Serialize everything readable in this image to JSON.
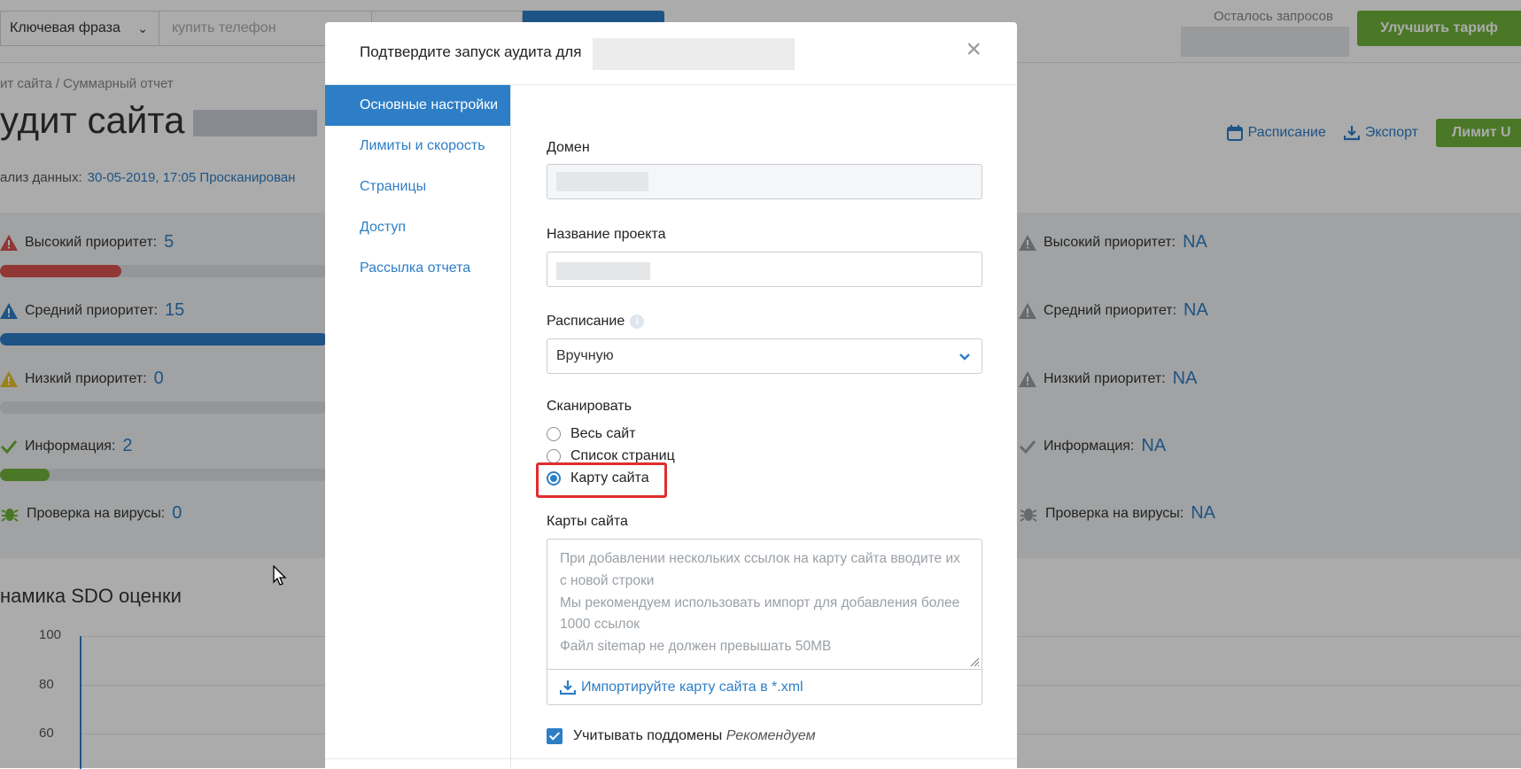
{
  "topbar": {
    "keyword_select": "Ключевая фраза",
    "keyword_placeholder": "купить телефон",
    "remaining_label": "Осталось запросов",
    "upgrade_button": "Улучшить тариф"
  },
  "page": {
    "breadcrumb": "ит сайта / Суммарный отчет",
    "title": "удит сайта",
    "data_label": "ализ данных:",
    "data_value": "30-05-2019, 17:05 Просканирован",
    "actions": {
      "schedule": "Расписание",
      "export": "Экспорт",
      "limit": "Лимит U"
    }
  },
  "stats_left": [
    {
      "label": "Высокий приоритет:",
      "value": "5",
      "color": "#d9534f",
      "fill": 0.37
    },
    {
      "label": "Средний приоритет:",
      "value": "15",
      "color": "#2d7ec6",
      "fill": 1.0
    },
    {
      "label": "Низкий приоритет:",
      "value": "0",
      "color": "#e6c02b",
      "fill": 0
    },
    {
      "label": "Информация:",
      "value": "2",
      "color": "#6fb33a",
      "fill": 0.15
    },
    {
      "label": "Проверка на вирусы:",
      "value": "0",
      "color": "#6fb33a",
      "fill": 0
    }
  ],
  "stats_right": [
    {
      "label": "Высокий приоритет:",
      "value": "NA"
    },
    {
      "label": "Средний приоритет:",
      "value": "NA"
    },
    {
      "label": "Низкий приоритет:",
      "value": "NA"
    },
    {
      "label": "Информация:",
      "value": "NA"
    },
    {
      "label": "Проверка на вирусы:",
      "value": "NA"
    }
  ],
  "chart": {
    "title": "намика SDO оценки",
    "y_ticks": [
      "100",
      "80",
      "60"
    ]
  },
  "modal": {
    "title": "Подтвердите запуск аудита для",
    "close": "×",
    "nav": [
      "Основные настройки",
      "Лимиты и скорость",
      "Страницы",
      "Доступ",
      "Рассылка отчета"
    ],
    "domain_label": "Домен",
    "project_label": "Название проекта",
    "schedule_label": "Расписание",
    "schedule_info": "i",
    "schedule_value": "Вручную",
    "scan_label": "Сканировать",
    "scan_options": [
      "Весь сайт",
      "Список страниц",
      "Карту сайта"
    ],
    "scan_selected": "Карту сайта",
    "sitemaps_label": "Карты сайта",
    "sitemaps_placeholder": [
      "При добавлении нескольких ссылок на карту сайта вводите их с новой строки",
      "Мы рекомендуем использовать импорт для добавления более 1000 ссылок",
      "Файл sitemap не должен превышать 50MB"
    ],
    "import_link": "Импортируйте карту сайта в *.xml",
    "subdomains_label": "Учитывать поддомены",
    "subdomains_note": "Рекомендуем",
    "subdomains_checked": true
  },
  "colors": {
    "accent": "#2d7ec6",
    "green": "#6fb33a",
    "highlight": "#e02d2d"
  }
}
